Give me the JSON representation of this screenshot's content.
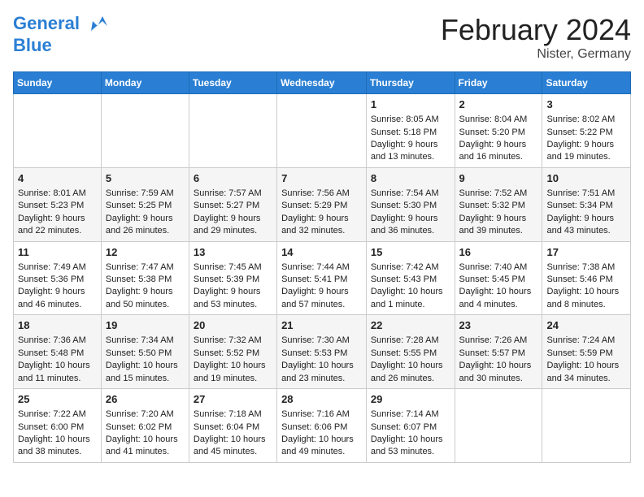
{
  "header": {
    "logo_line1": "General",
    "logo_line2": "Blue",
    "title": "February 2024",
    "subtitle": "Nister, Germany"
  },
  "weekdays": [
    "Sunday",
    "Monday",
    "Tuesday",
    "Wednesday",
    "Thursday",
    "Friday",
    "Saturday"
  ],
  "weeks": [
    [
      {
        "day": "",
        "info": ""
      },
      {
        "day": "",
        "info": ""
      },
      {
        "day": "",
        "info": ""
      },
      {
        "day": "",
        "info": ""
      },
      {
        "day": "1",
        "info": "Sunrise: 8:05 AM\nSunset: 5:18 PM\nDaylight: 9 hours\nand 13 minutes."
      },
      {
        "day": "2",
        "info": "Sunrise: 8:04 AM\nSunset: 5:20 PM\nDaylight: 9 hours\nand 16 minutes."
      },
      {
        "day": "3",
        "info": "Sunrise: 8:02 AM\nSunset: 5:22 PM\nDaylight: 9 hours\nand 19 minutes."
      }
    ],
    [
      {
        "day": "4",
        "info": "Sunrise: 8:01 AM\nSunset: 5:23 PM\nDaylight: 9 hours\nand 22 minutes."
      },
      {
        "day": "5",
        "info": "Sunrise: 7:59 AM\nSunset: 5:25 PM\nDaylight: 9 hours\nand 26 minutes."
      },
      {
        "day": "6",
        "info": "Sunrise: 7:57 AM\nSunset: 5:27 PM\nDaylight: 9 hours\nand 29 minutes."
      },
      {
        "day": "7",
        "info": "Sunrise: 7:56 AM\nSunset: 5:29 PM\nDaylight: 9 hours\nand 32 minutes."
      },
      {
        "day": "8",
        "info": "Sunrise: 7:54 AM\nSunset: 5:30 PM\nDaylight: 9 hours\nand 36 minutes."
      },
      {
        "day": "9",
        "info": "Sunrise: 7:52 AM\nSunset: 5:32 PM\nDaylight: 9 hours\nand 39 minutes."
      },
      {
        "day": "10",
        "info": "Sunrise: 7:51 AM\nSunset: 5:34 PM\nDaylight: 9 hours\nand 43 minutes."
      }
    ],
    [
      {
        "day": "11",
        "info": "Sunrise: 7:49 AM\nSunset: 5:36 PM\nDaylight: 9 hours\nand 46 minutes."
      },
      {
        "day": "12",
        "info": "Sunrise: 7:47 AM\nSunset: 5:38 PM\nDaylight: 9 hours\nand 50 minutes."
      },
      {
        "day": "13",
        "info": "Sunrise: 7:45 AM\nSunset: 5:39 PM\nDaylight: 9 hours\nand 53 minutes."
      },
      {
        "day": "14",
        "info": "Sunrise: 7:44 AM\nSunset: 5:41 PM\nDaylight: 9 hours\nand 57 minutes."
      },
      {
        "day": "15",
        "info": "Sunrise: 7:42 AM\nSunset: 5:43 PM\nDaylight: 10 hours\nand 1 minute."
      },
      {
        "day": "16",
        "info": "Sunrise: 7:40 AM\nSunset: 5:45 PM\nDaylight: 10 hours\nand 4 minutes."
      },
      {
        "day": "17",
        "info": "Sunrise: 7:38 AM\nSunset: 5:46 PM\nDaylight: 10 hours\nand 8 minutes."
      }
    ],
    [
      {
        "day": "18",
        "info": "Sunrise: 7:36 AM\nSunset: 5:48 PM\nDaylight: 10 hours\nand 11 minutes."
      },
      {
        "day": "19",
        "info": "Sunrise: 7:34 AM\nSunset: 5:50 PM\nDaylight: 10 hours\nand 15 minutes."
      },
      {
        "day": "20",
        "info": "Sunrise: 7:32 AM\nSunset: 5:52 PM\nDaylight: 10 hours\nand 19 minutes."
      },
      {
        "day": "21",
        "info": "Sunrise: 7:30 AM\nSunset: 5:53 PM\nDaylight: 10 hours\nand 23 minutes."
      },
      {
        "day": "22",
        "info": "Sunrise: 7:28 AM\nSunset: 5:55 PM\nDaylight: 10 hours\nand 26 minutes."
      },
      {
        "day": "23",
        "info": "Sunrise: 7:26 AM\nSunset: 5:57 PM\nDaylight: 10 hours\nand 30 minutes."
      },
      {
        "day": "24",
        "info": "Sunrise: 7:24 AM\nSunset: 5:59 PM\nDaylight: 10 hours\nand 34 minutes."
      }
    ],
    [
      {
        "day": "25",
        "info": "Sunrise: 7:22 AM\nSunset: 6:00 PM\nDaylight: 10 hours\nand 38 minutes."
      },
      {
        "day": "26",
        "info": "Sunrise: 7:20 AM\nSunset: 6:02 PM\nDaylight: 10 hours\nand 41 minutes."
      },
      {
        "day": "27",
        "info": "Sunrise: 7:18 AM\nSunset: 6:04 PM\nDaylight: 10 hours\nand 45 minutes."
      },
      {
        "day": "28",
        "info": "Sunrise: 7:16 AM\nSunset: 6:06 PM\nDaylight: 10 hours\nand 49 minutes."
      },
      {
        "day": "29",
        "info": "Sunrise: 7:14 AM\nSunset: 6:07 PM\nDaylight: 10 hours\nand 53 minutes."
      },
      {
        "day": "",
        "info": ""
      },
      {
        "day": "",
        "info": ""
      }
    ]
  ]
}
